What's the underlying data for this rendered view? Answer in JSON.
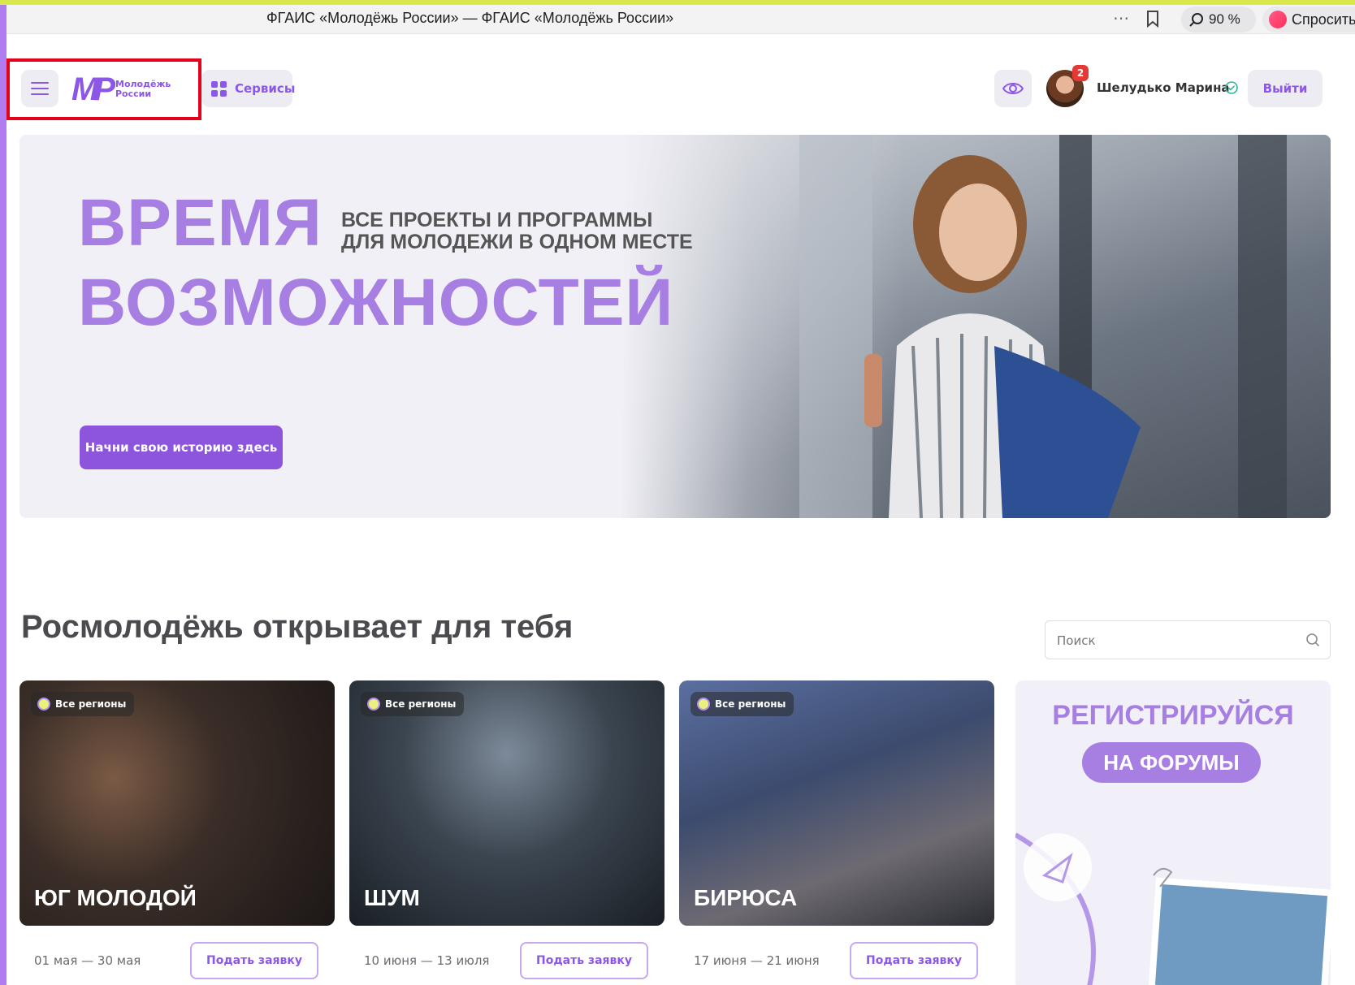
{
  "browser": {
    "title": "ФГАИС «Молодёжь России» — ФГАИС «Молодёжь России»",
    "zoom": "90 %",
    "ask": "Спросить"
  },
  "header": {
    "logo_line1": "Молодёжь",
    "logo_line2": "России",
    "services_label": "Сервисы",
    "notifications_count": "2",
    "user_name": "Шелудько Марина",
    "logout_label": "Выйти"
  },
  "hero": {
    "title_line1": "ВРЕМЯ",
    "title_line2": "ВОЗМОЖНОСТЕЙ",
    "subtitle_line1": "ВСЕ ПРОЕКТЫ И ПРОГРАММЫ",
    "subtitle_line2": "ДЛЯ МОЛОДЕЖИ В ОДНОМ МЕСТЕ",
    "cta_label": "Начни свою историю здесь"
  },
  "section": {
    "title": "Росмолодёжь открывает для тебя",
    "search_placeholder": "Поиск"
  },
  "cards": [
    {
      "region": "Все регионы",
      "name": "ЮГ МОЛОДОЙ",
      "dates": "01 мая — 30 мая",
      "apply": "Подать заявку"
    },
    {
      "region": "Все регионы",
      "name": "ШУМ",
      "dates": "10 июня — 13 июля",
      "apply": "Подать заявку"
    },
    {
      "region": "Все регионы",
      "name": "БИРЮСА",
      "dates": "17 июня — 21 июня",
      "apply": "Подать заявку"
    }
  ],
  "promo": {
    "line1": "РЕГИСТРИРУЙСЯ",
    "line2": "НА ФОРУМЫ"
  },
  "colors": {
    "accent": "#8c57e6",
    "hero_title": "#a77ee2",
    "highlight": "#e5001c"
  }
}
